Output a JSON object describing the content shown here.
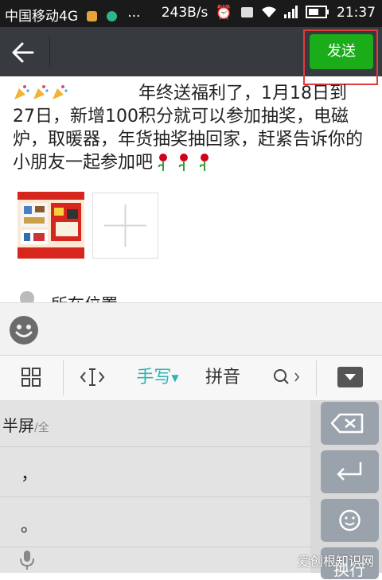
{
  "status_bar": {
    "carrier": "中国移动4G",
    "speed": "243B/s",
    "dots": "···",
    "time": "21:37",
    "network_tag": "4G"
  },
  "top_bar": {
    "send_label": "发送",
    "accent_color": "#1aad19",
    "highlight_color": "#e23b3b"
  },
  "post": {
    "line1": "年终送福利了，1月18日到",
    "line2": "27日，新增100积分就可以参加抽奖，电磁",
    "line3": "炉，取暖器，年货抽奖抽回家，赶紧告诉你的",
    "line4": "小朋友一起参加吧",
    "emoji_prefix_icons": [
      "party-popper-icon",
      "party-popper-icon",
      "party-popper-icon"
    ],
    "emoji_suffix_icons": [
      "rose-icon",
      "rose-icon",
      "rose-icon"
    ]
  },
  "photos": {
    "attached_count": 1,
    "add_icon": "plus-icon"
  },
  "location": {
    "label": "所在位置"
  },
  "ime_toolbar": {
    "handwriting": "手写",
    "pinyin": "拼音",
    "handwriting_color": "#2fb4b8"
  },
  "keyboard": {
    "halfwidth_label": "半屏",
    "fullwidth_label": "/全",
    "comma": "，",
    "period": "。",
    "next_label": "换行"
  },
  "watermark": "爱创根知识网"
}
